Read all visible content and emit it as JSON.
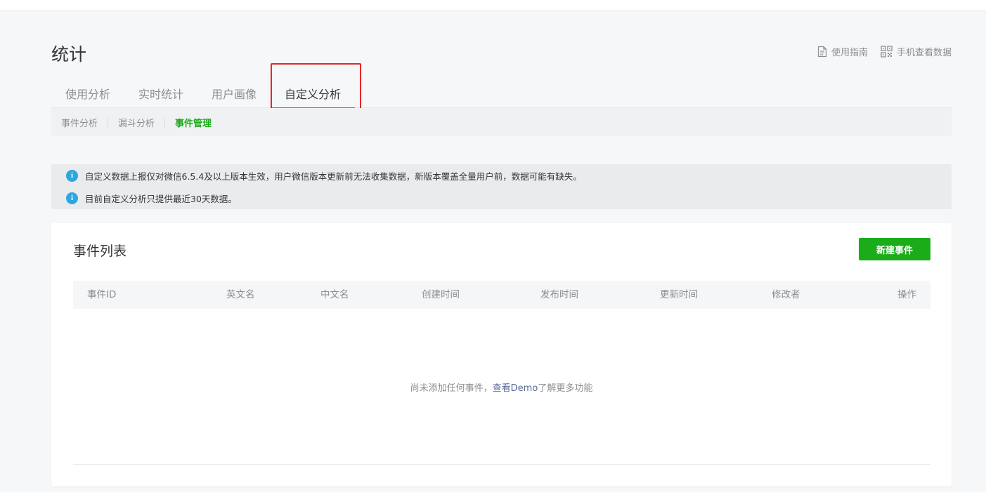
{
  "page": {
    "title": "统计"
  },
  "top_links": {
    "guide": "使用指南",
    "mobile": "手机查看数据"
  },
  "tabs": [
    {
      "label": "使用分析",
      "active": false
    },
    {
      "label": "实时统计",
      "active": false
    },
    {
      "label": "用户画像",
      "active": false
    },
    {
      "label": "自定义分析",
      "active": true
    }
  ],
  "subtabs": [
    {
      "label": "事件分析",
      "active": false
    },
    {
      "label": "漏斗分析",
      "active": false
    },
    {
      "label": "事件管理",
      "active": true
    }
  ],
  "notices": [
    "自定义数据上报仅对微信6.5.4及以上版本生效，用户微信版本更新前无法收集数据，新版本覆盖全量用户前，数据可能有缺失。",
    "目前自定义分析只提供最近30天数据。"
  ],
  "event_list": {
    "title": "事件列表",
    "new_button": "新建事件",
    "columns": [
      "事件ID",
      "英文名",
      "中文名",
      "创建时间",
      "发布时间",
      "更新时间",
      "修改者",
      "操作"
    ],
    "empty_prefix": "尚未添加任何事件，",
    "empty_link": "查看Demo",
    "empty_suffix": "了解更多功能"
  },
  "colors": {
    "accent": "#1aad19",
    "highlight": "#e5262a",
    "info": "#2ea7e0",
    "link": "#576b95"
  }
}
